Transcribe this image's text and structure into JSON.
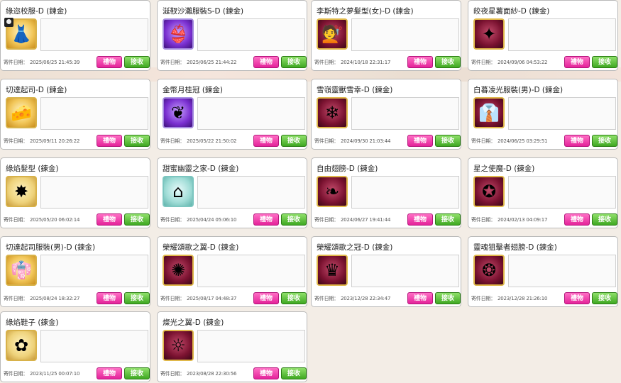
{
  "labels": {
    "date_label": "寄件日期：",
    "gift_button": "禮物",
    "receive_button": "接收"
  },
  "items": [
    {
      "name": "綠迩校服-D (鍊金)",
      "date": "2025/06/25 21:45:39",
      "icon": "uniform-icon"
    },
    {
      "name": "涎靫沙灘服裝S-D (鍊金)",
      "date": "2025/06/25 21:44:22",
      "icon": "swimsuit-icon"
    },
    {
      "name": "李斯特之夢髮型(女)-D (鍊金)",
      "date": "2024/10/18 22:31:17",
      "icon": "hairstyle-icon"
    },
    {
      "name": "皎夜星薯面紗-D (鍊金)",
      "date": "2024/09/06 04:53:22",
      "icon": "veil-icon"
    },
    {
      "name": "切達起司-D (鍊金)",
      "date": "2025/09/11 20:26:22",
      "icon": "cheese-pet-icon"
    },
    {
      "name": "金幣月桂冠 (鍊金)",
      "date": "2025/05/22 21:50:02",
      "icon": "laurel-crown-icon"
    },
    {
      "name": "雪嶺靈獸雪幸-D (鍊金)",
      "date": "2024/09/30 21:03:44",
      "icon": "snow-beast-icon"
    },
    {
      "name": "白暮凌光服裝(男)-D (鍊金)",
      "date": "2024/06/25 03:29:51",
      "icon": "white-outfit-icon"
    },
    {
      "name": "綠焰髮型 (鍊金)",
      "date": "2025/05/20 06:02:14",
      "icon": "green-flame-icon"
    },
    {
      "name": "甜蜜幽靈之家-D (鍊金)",
      "date": "2025/04/24 05:06:10",
      "icon": "ghost-house-icon"
    },
    {
      "name": "自由翅膀-D (鍊金)",
      "date": "2024/06/27 19:41:44",
      "icon": "wing-icon"
    },
    {
      "name": "星之使魔-D (鍊金)",
      "date": "2024/02/13 04:09:17",
      "icon": "star-familiar-icon"
    },
    {
      "name": "切達起司服裝(男)-D (鍊金)",
      "date": "2025/08/24 18:32:27",
      "icon": "cheese-outfit-icon"
    },
    {
      "name": "榮耀頌歌之翼-D (鍊金)",
      "date": "2025/08/17 04:48:37",
      "icon": "glory-wings-icon"
    },
    {
      "name": "榮耀頌歌之冠-D (鍊金)",
      "date": "2023/12/28 22:34:47",
      "icon": "glory-crown-icon"
    },
    {
      "name": "靈魂狙擊者翅膀-D (鍊金)",
      "date": "2023/12/28 21:26:10",
      "icon": "soul-wings-icon"
    },
    {
      "name": "綠焰鞋子 (鍊金)",
      "date": "2023/11/25 00:07:10",
      "icon": "green-shoes-icon"
    },
    {
      "name": "燦光之翼-D (鍊金)",
      "date": "2023/08/28 22:30:56",
      "icon": "radiant-wings-icon"
    }
  ]
}
